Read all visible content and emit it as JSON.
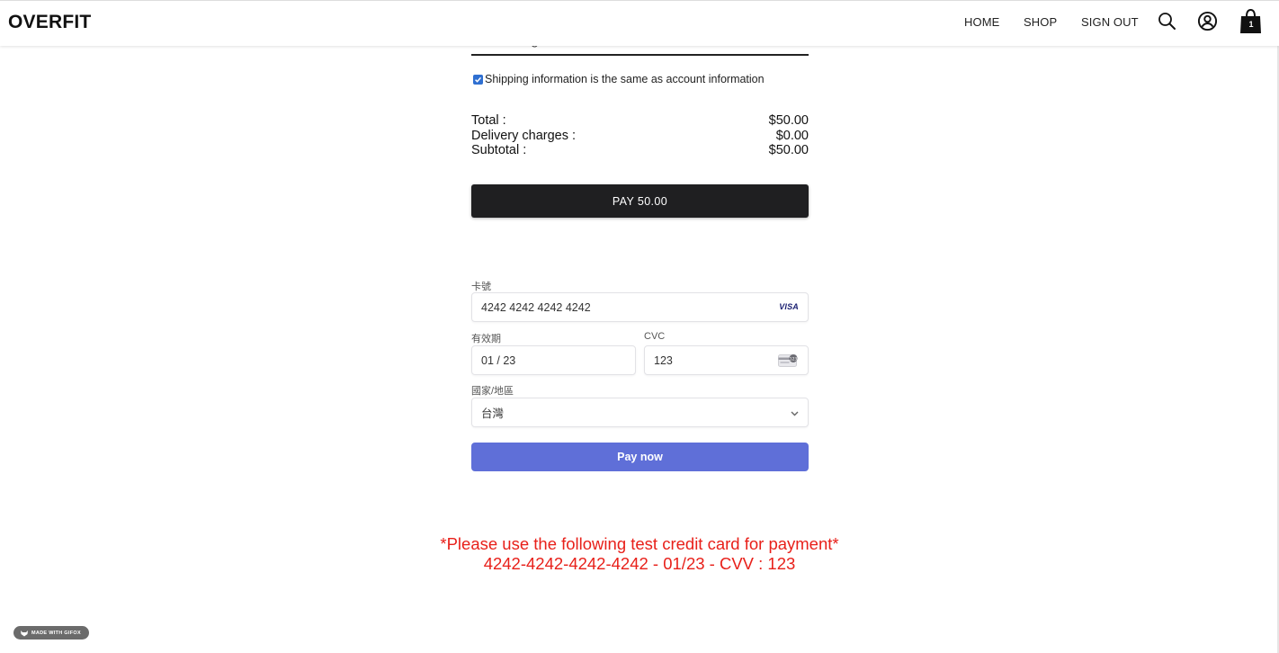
{
  "header": {
    "logo": "OVERFIT",
    "nav": {
      "home": "HOME",
      "shop": "SHOP",
      "sign_out": "SIGN OUT"
    },
    "icons": {
      "search": "search-icon",
      "account": "account-icon",
      "cart": "shopping-bag-icon"
    },
    "cart_count": "1"
  },
  "checkout": {
    "hidden_heading": "g",
    "shipping_same_label": "Shipping information is the same as account information",
    "shipping_same_checked": true,
    "summary": {
      "total_label": "Total :",
      "total_value": "$50.00",
      "delivery_label": "Delivery charges :",
      "delivery_value": "$0.00",
      "subtotal_label": "Subtotal :",
      "subtotal_value": "$50.00"
    },
    "pay_button": "PAY 50.00"
  },
  "stripe_form": {
    "card_label": "卡號",
    "card_value": "4242 4242 4242 4242",
    "card_brand": "VISA",
    "expiry_label": "有效期",
    "expiry_value": "01 / 23",
    "cvc_label": "CVC",
    "cvc_value": "123",
    "country_label": "國家/地區",
    "country_value": "台灣",
    "pay_now": "Pay now"
  },
  "test_note": {
    "line1": "*Please use the following test credit card for payment*",
    "line2": "4242-4242-4242-4242 - 01/23 - CVV : 123"
  },
  "badge": {
    "text": "MADE WITH GIFOX"
  },
  "colors": {
    "accent_pay_now": "#5f6fd8",
    "pay_button": "#1f1f21",
    "note_red": "#e8201a",
    "checkbox_blue": "#2f6fd1"
  }
}
